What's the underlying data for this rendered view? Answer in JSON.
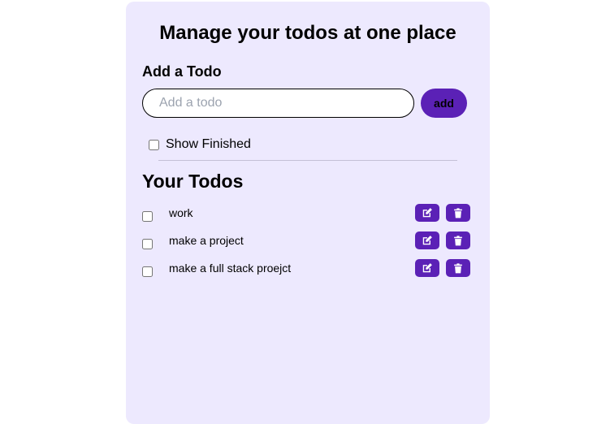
{
  "header": {
    "title": "Manage your todos at one place"
  },
  "add_section": {
    "heading": "Add a Todo",
    "input_value": "",
    "input_placeholder": "Add a todo",
    "add_label": "add"
  },
  "filter": {
    "show_finished_label": "Show Finished",
    "show_finished_checked": false
  },
  "todos_section": {
    "heading": "Your Todos",
    "items": [
      {
        "text": "work",
        "done": false
      },
      {
        "text": "make a project",
        "done": false
      },
      {
        "text": "make a full stack proejct",
        "done": false
      }
    ]
  },
  "icons": {
    "edit": "edit-icon",
    "delete": "trash-icon"
  },
  "colors": {
    "card_background": "#ede9fe",
    "accent": "#5b21b6",
    "page_background": "#ffffff"
  }
}
